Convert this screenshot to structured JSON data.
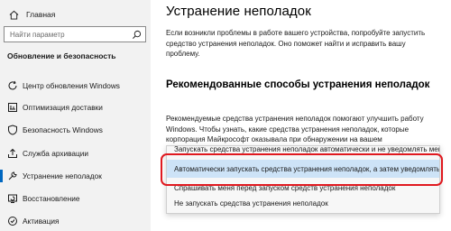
{
  "sidebar": {
    "home_label": "Главная",
    "search_placeholder": "Найти параметр",
    "section_title": "Обновление и безопасность",
    "items": [
      {
        "label": "Центр обновления Windows",
        "icon": "refresh-icon"
      },
      {
        "label": "Оптимизация доставки",
        "icon": "delivery-optimization-icon"
      },
      {
        "label": "Безопасность Windows",
        "icon": "shield-icon"
      },
      {
        "label": "Служба архивации",
        "icon": "backup-icon"
      },
      {
        "label": "Устранение неполадок",
        "icon": "wrench-icon"
      },
      {
        "label": "Восстановление",
        "icon": "recovery-icon"
      },
      {
        "label": "Активация",
        "icon": "activation-icon"
      }
    ],
    "active_index": 4
  },
  "main": {
    "title": "Устранение неполадок",
    "intro": "Если возникли проблемы в работе вашего устройства, попробуйте запустить средство устранения неполадок. Оно поможет найти и исправить вашу проблему.",
    "subtitle": "Рекомендованные способы устранения неполадок",
    "recommended_text": "Рекомендуемые средства устранения неполадок помогают улучшить работу Windows. Чтобы узнать, какие средства устранения неполадок, которые корпорация Майкрософт оказывала при обнаружении на вашем"
  },
  "dropdown": {
    "options": [
      "Запускать средства устранения неполадок автоматически и не уведомлять меня",
      "Автоматически запускать средства устранения неполадок, а затем уведомлять меня",
      "Спрашивать меня перед запуском средств устранения неполадок",
      "Не запускать средства устранения неполадок"
    ],
    "selected_index": 1
  },
  "colors": {
    "accent": "#0067c0",
    "highlight": "#e0191f",
    "selected_bg": "#cde3f7"
  }
}
